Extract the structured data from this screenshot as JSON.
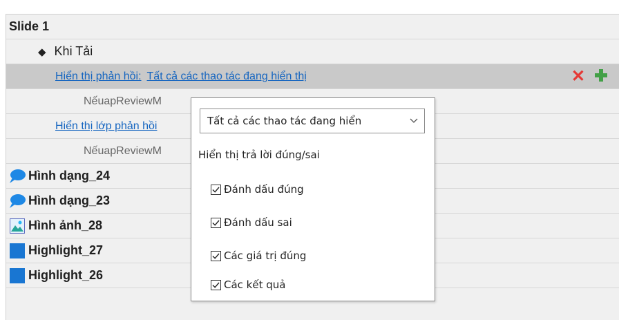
{
  "tree": {
    "slide_label": "Slide 1",
    "trigger_label": "Khi Tải",
    "feedback_prefix": "Hiển thị phản hồi:",
    "feedback_value": "Tất cả các thao tác đang hiển thị",
    "condition_1": "NếuapReviewM",
    "feedback_layer_label": "Hiển thị lớp phản hồi",
    "condition_2": "NếuapReviewM",
    "items": [
      {
        "label": "Hình dạng_24",
        "icon": "speech-bubble-icon"
      },
      {
        "label": "Hình dạng_23",
        "icon": "speech-bubble-icon"
      },
      {
        "label": "Hình ảnh_28",
        "icon": "image-icon"
      },
      {
        "label": "Highlight_27",
        "icon": "highlight-square-icon"
      },
      {
        "label": "Highlight_26",
        "icon": "highlight-square-icon"
      }
    ]
  },
  "popup": {
    "select_value": "Tất cả các thao tác đang hiển",
    "heading": "Hiển thị trả lời đúng/sai",
    "options": [
      {
        "label": "Đánh dấu đúng",
        "checked": true
      },
      {
        "label": "Đánh dấu sai",
        "checked": true
      },
      {
        "label": "Các giá trị đúng",
        "checked": true
      },
      {
        "label": "Các kết quả",
        "checked": true
      }
    ]
  },
  "colors": {
    "link": "#1565c0",
    "delete": "#e53935",
    "add": "#43a047",
    "speech_bubble": "#1e88e5",
    "highlight_square": "#1976d2"
  }
}
